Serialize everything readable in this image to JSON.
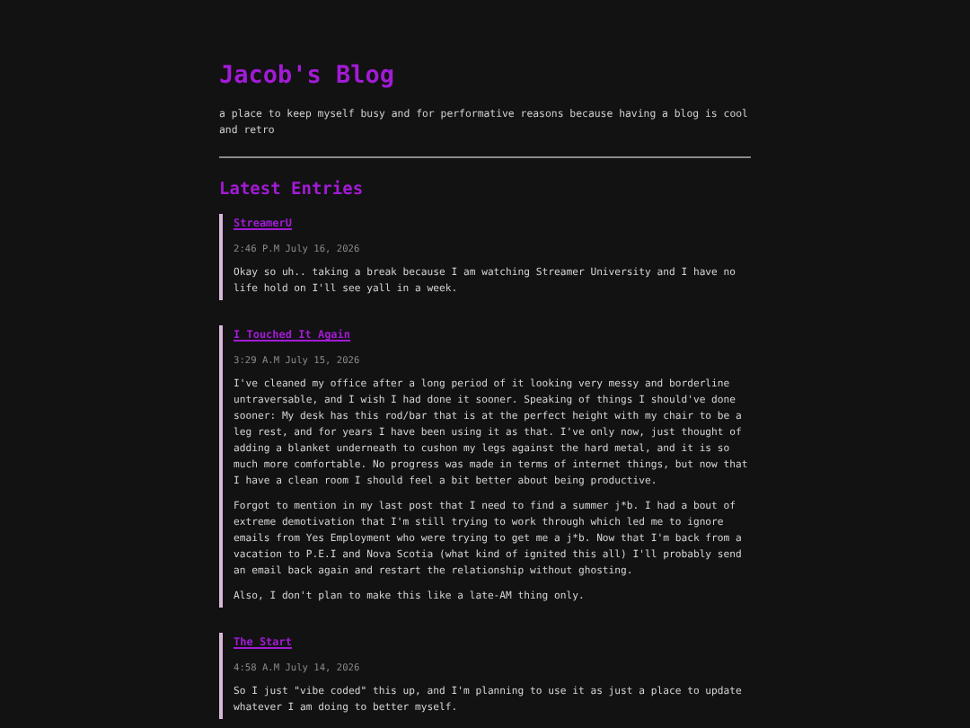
{
  "blog": {
    "title": "Jacob's Blog",
    "tagline": "a place to keep myself busy and for performative reasons because having a blog is cool and retro"
  },
  "section_heading": "Latest Entries",
  "entries": [
    {
      "title": "StreamerU",
      "date": "2:46 P.M July 16, 2026",
      "paragraphs": [
        "Okay so uh.. taking a break because I am watching Streamer University and I have no life hold on I'll see yall in a week."
      ]
    },
    {
      "title": "I Touched It Again",
      "date": "3:29 A.M July 15, 2026",
      "paragraphs": [
        "I've cleaned my office after a long period of it looking very messy and borderline untraversable, and I wish I had done it sooner. Speaking of things I should've done sooner: My desk has this rod/bar that is at the perfect height with my chair to be a leg rest, and for years I have been using it as that. I've only now, just thought of adding a blanket underneath to cushon my legs against the hard metal, and it is so much more comfortable. No progress was made in terms of internet things, but now that I have a clean room I should feel a bit better about being productive.",
        "Forgot to mention in my last post that I need to find a summer j*b. I had a bout of extreme demotivation that I'm still trying to work through which led me to ignore emails from Yes Employment who were trying to get me a j*b. Now that I'm back from a vacation to P.E.I and Nova Scotia (what kind of ignited this all) I'll probably send an email back again and restart the relationship without ghosting.",
        "Also, I don't plan to make this like a late-AM thing only."
      ]
    },
    {
      "title": "The Start",
      "date": "4:58 A.M July 14, 2026",
      "paragraphs": [
        "So I just \"vibe coded\" this up, and I'm planning to use it as just a place to update whatever I am doing to better myself."
      ]
    }
  ]
}
